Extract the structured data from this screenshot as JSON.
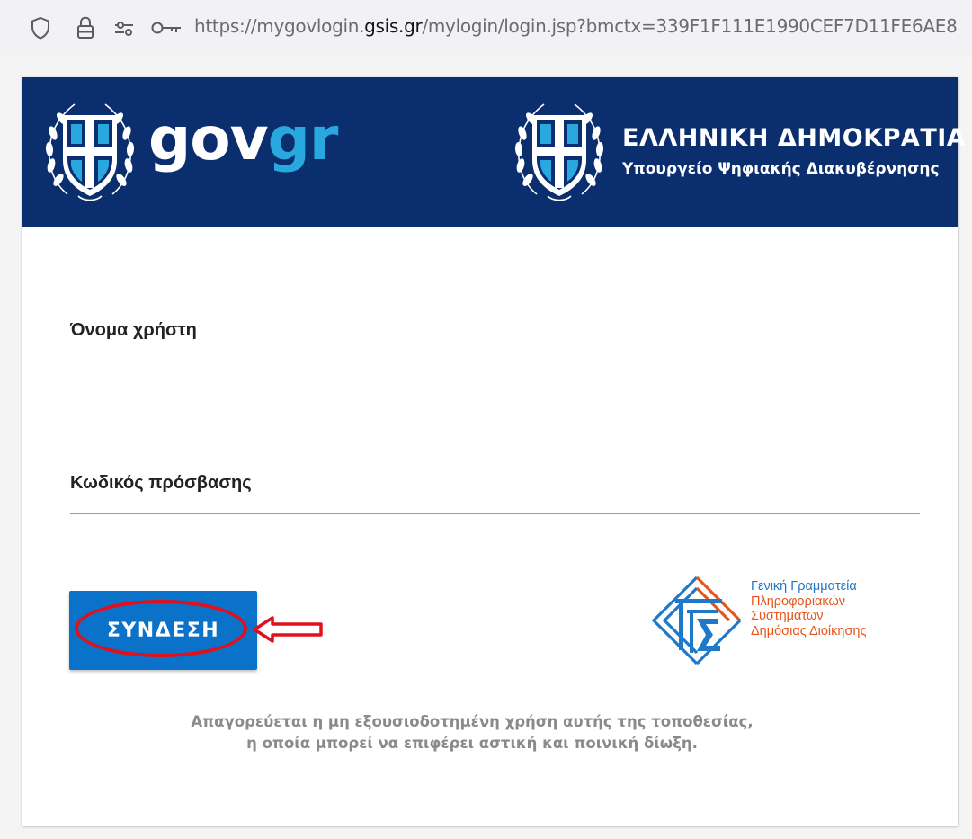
{
  "browser": {
    "url_prefix": "https://mygovlogin.",
    "url_domain": "gsis.gr",
    "url_suffix": "/mylogin/login.jsp?bmctx=339F1F111E1990CEF7D11FE6AE8"
  },
  "header": {
    "logo_gov": "gov",
    "logo_gr": "gr",
    "republic_title": "ΕΛΛΗΝΙΚΗ ΔΗΜΟΚΡΑΤΙΑ",
    "ministry": "Υπουργείο Ψηφιακής Διακυβέρνησης"
  },
  "form": {
    "username_label": "Όνομα χρήστη",
    "username_value": "",
    "password_label": "Κωδικός πρόσβασης",
    "password_value": "",
    "login_button": "ΣΥΝΔΕΣΗ"
  },
  "gsis": {
    "line1": "Γενική Γραμματεία",
    "line2": "Πληροφοριακών",
    "line3": "Συστημάτων",
    "line4": "Δημόσιας Διοίκησης"
  },
  "warning": {
    "line1": "Απαγορεύεται η μη εξουσιοδοτημένη χρήση αυτής της τοποθεσίας,",
    "line2": "η οποία μπορεί να επιφέρει αστική και ποινική δίωξη."
  },
  "colors": {
    "header_bg": "#0b2e6f",
    "gr_accent": "#29a8e0",
    "button_bg": "#0a72c8",
    "annotation_red": "#e0101c",
    "gsis_blue": "#1f78c8",
    "gsis_orange": "#e8541e"
  },
  "icons": [
    "shield-icon",
    "lock-icon",
    "permissions-icon",
    "key-icon",
    "greek-emblem-icon",
    "gsis-logo-icon",
    "red-arrow-annotation"
  ]
}
